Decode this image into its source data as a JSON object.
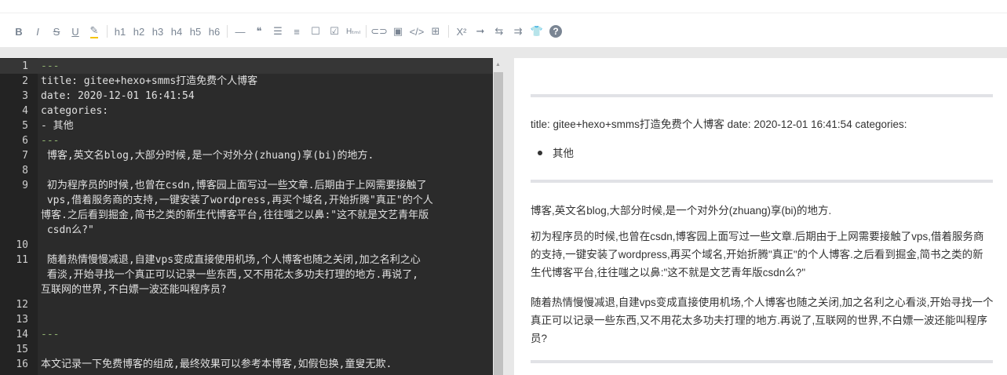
{
  "toolbar": {
    "items": [
      {
        "icon": "bold-icon",
        "label": "B"
      },
      {
        "icon": "italic-icon",
        "label": "I"
      },
      {
        "icon": "strikethrough-icon",
        "label": "S"
      },
      {
        "icon": "underline-icon",
        "label": "U"
      },
      {
        "icon": "highlight-icon",
        "label": "✎"
      },
      {
        "icon": "h1-icon",
        "label": "h1"
      },
      {
        "icon": "h2-icon",
        "label": "h2"
      },
      {
        "icon": "h3-icon",
        "label": "h3"
      },
      {
        "icon": "h4-icon",
        "label": "h4"
      },
      {
        "icon": "h5-icon",
        "label": "h5"
      },
      {
        "icon": "h6-icon",
        "label": "h6"
      },
      {
        "icon": "hr-icon",
        "label": "—"
      },
      {
        "icon": "quote-icon",
        "label": "❝"
      },
      {
        "icon": "unordered-list-icon",
        "label": "☰"
      },
      {
        "icon": "ordered-list-icon",
        "label": "≡"
      },
      {
        "icon": "checkbox-icon",
        "label": "☐"
      },
      {
        "icon": "task-icon",
        "label": "☑"
      },
      {
        "icon": "html-icon",
        "label": "Hₜₘₗ"
      },
      {
        "icon": "link-icon",
        "label": "⊂⊃"
      },
      {
        "icon": "image-icon",
        "label": "▣"
      },
      {
        "icon": "code-icon",
        "label": "</>"
      },
      {
        "icon": "table-icon",
        "label": "⊞"
      },
      {
        "icon": "superscript-icon",
        "label": "X²"
      },
      {
        "icon": "arrow-right-icon",
        "label": "➞"
      },
      {
        "icon": "swap-icon",
        "label": "⇆"
      },
      {
        "icon": "align-icon",
        "label": "⇉"
      },
      {
        "icon": "theme-shirt-icon",
        "label": "👕"
      },
      {
        "icon": "help-icon",
        "label": "?"
      }
    ]
  },
  "editor": {
    "lines": [
      {
        "n": "1",
        "t": "---"
      },
      {
        "n": "2",
        "t": "title: gitee+hexo+smms打造免费个人博客"
      },
      {
        "n": "3",
        "t": "date: 2020-12-01 16:41:54"
      },
      {
        "n": "4",
        "t": "categories:"
      },
      {
        "n": "5",
        "t": "- 其他"
      },
      {
        "n": "6",
        "t": "---"
      },
      {
        "n": "7",
        "t": " 博客,英文名blog,大部分时候,是一个对外分(zhuang)享(bi)的地方."
      },
      {
        "n": "8",
        "t": ""
      },
      {
        "n": "9",
        "t": " 初为程序员的时候,也曾在csdn,博客园上面写过一些文章.后期由于上网需要接触了"
      },
      {
        "n": "",
        "t": " vps,借着服务商的支持,一键安装了wordpress,再买个域名,开始折腾\"真正\"的个人"
      },
      {
        "n": "",
        "t": "博客.之后看到掘金,简书之类的新生代博客平台,往往嗤之以鼻:\"这不就是文艺青年版"
      },
      {
        "n": "",
        "t": " csdn么?\""
      },
      {
        "n": "10",
        "t": ""
      },
      {
        "n": "11",
        "t": " 随着热情慢慢减退,自建vps变成直接使用机场,个人博客也随之关闭,加之名利之心"
      },
      {
        "n": "",
        "t": " 看淡,开始寻找一个真正可以记录一些东西,又不用花太多功夫打理的地方.再说了,"
      },
      {
        "n": "",
        "t": "互联网的世界,不白嫖一波还能叫程序员?"
      },
      {
        "n": "12",
        "t": ""
      },
      {
        "n": "13",
        "t": ""
      },
      {
        "n": "14",
        "t": "---"
      },
      {
        "n": "15",
        "t": ""
      },
      {
        "n": "16",
        "t": "本文记录一下免费博客的组成,最终效果可以参考本博客,如假包换,童叟无欺."
      }
    ]
  },
  "preview": {
    "meta": "title: gitee+hexo+smms打造免费个人博客 date: 2020-12-01 16:41:54 categories:",
    "category": "其他",
    "p1": "博客,英文名blog,大部分时候,是一个对外分(zhuang)享(bi)的地方.",
    "p2": "初为程序员的时候,也曾在csdn,博客园上面写过一些文章.后期由于上网需要接触了vps,借着服务商的支持,一键安装了wordpress,再买个域名,开始折腾\"真正\"的个人博客.之后看到掘金,简书之类的新生代博客平台,往往嗤之以鼻:\"这不就是文艺青年版csdn么?\"",
    "p3": "随着热情慢慢减退,自建vps变成直接使用机场,个人博客也随之关闭,加之名利之心看淡,开始寻找一个真正可以记录一些东西,又不用花太多功夫打理的地方.再说了,互联网的世界,不白嫖一波还能叫程序员?"
  }
}
